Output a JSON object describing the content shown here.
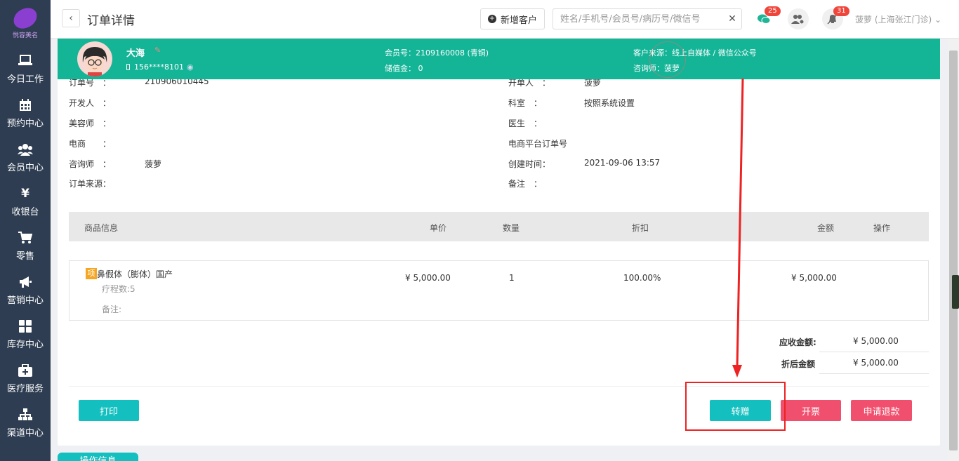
{
  "sidebar": {
    "logo_text": "悦容美名",
    "items": [
      {
        "label": "今日工作",
        "icon": "laptop-icon"
      },
      {
        "label": "预约中心",
        "icon": "calendar-icon"
      },
      {
        "label": "会员中心",
        "icon": "users-icon"
      },
      {
        "label": "收银台",
        "icon": "yen-icon"
      },
      {
        "label": "零售",
        "icon": "cart-icon"
      },
      {
        "label": "营销中心",
        "icon": "megaphone-icon"
      },
      {
        "label": "库存中心",
        "icon": "grid-icon"
      },
      {
        "label": "医疗服务",
        "icon": "medkit-icon"
      },
      {
        "label": "渠道中心",
        "icon": "sitemap-icon"
      }
    ]
  },
  "header": {
    "back": "‹",
    "title": "订单详情",
    "new_customer": "新增客户",
    "search_placeholder": "姓名/手机号/会员号/病历号/微信号",
    "search_clear": "✕",
    "chat_badge": "25",
    "notify_badge": "31",
    "user": "菠萝 (上海张江门诊) ⌄"
  },
  "customer": {
    "name": "大海",
    "phone": "156****8101",
    "member_no": "会员号：2109160008 (青铜)",
    "balance": "储值金： 0",
    "source": "客户来源：线上自媒体 / 微信公众号",
    "consultant": "咨询师：菠萝"
  },
  "order": {
    "left": [
      {
        "label": "订单号　：",
        "value": "210906010445"
      },
      {
        "label": "开发人　：",
        "value": ""
      },
      {
        "label": "美容师　：",
        "value": ""
      },
      {
        "label": "电商　　：",
        "value": ""
      },
      {
        "label": "咨询师　：",
        "value": "菠萝"
      },
      {
        "label": "订单来源：",
        "value": ""
      }
    ],
    "right": [
      {
        "label": "开单人　：",
        "value": "菠萝"
      },
      {
        "label": "科室　：",
        "value": "按照系统设置"
      },
      {
        "label": "医生　：",
        "value": ""
      },
      {
        "label": "电商平台订单号",
        "value": ""
      },
      {
        "label": "创建时间：",
        "value": "2021-09-06 13:57"
      },
      {
        "label": "备注　：",
        "value": ""
      }
    ]
  },
  "table": {
    "headers": [
      "商品信息",
      "单价",
      "数量",
      "折扣",
      "金额",
      "操作"
    ],
    "item": {
      "tag": "项",
      "name": "鼻假体（膨体）国产",
      "sessions": "疗程数:5",
      "note": "备注:",
      "price": "¥ 5,000.00",
      "qty": "1",
      "discount": "100.00%",
      "amount": "¥ 5,000.00"
    }
  },
  "summary": {
    "receivable_label": "应收金额:",
    "receivable": "¥ 5,000.00",
    "discounted_label": "折后金额",
    "discounted": "¥ 5,000.00"
  },
  "actions": {
    "print": "打印",
    "transfer": "转赠",
    "invoice": "开票",
    "refund": "申请退款",
    "operation_info": "操作信息"
  },
  "colors": {
    "sidebar": "#2e3d51",
    "teal": "#14b497",
    "button_teal": "#14bfbf",
    "button_red": "#f0506e",
    "highlight": "#ee2222"
  }
}
